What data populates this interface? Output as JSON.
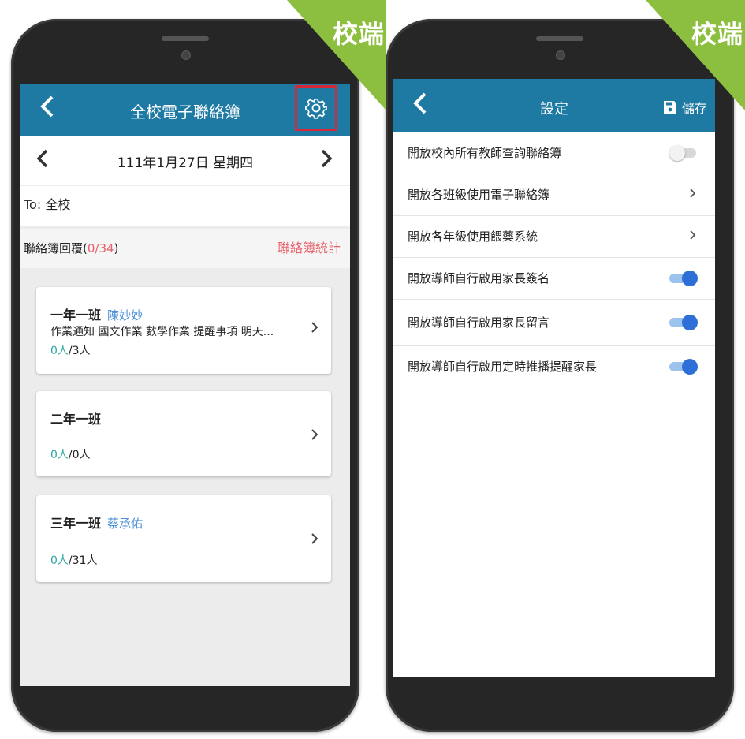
{
  "badges": {
    "left": "校端",
    "right": "校端"
  },
  "left_app": {
    "header": {
      "back_icon": "chevron-left-icon",
      "title": "全校電子聯絡簿",
      "settings_icon": "gear-icon"
    },
    "date_nav": {
      "prev_icon": "chevron-left-icon",
      "date": "111年1月27日 星期四",
      "next_icon": "chevron-right-icon"
    },
    "to_line": "To: 全校",
    "reply": {
      "label": "聯絡簿回覆(",
      "count": "0/34",
      "close": ")",
      "stats_link": "聯絡簿統計"
    },
    "classes": [
      {
        "name": "一年一班",
        "teacher": "陳妙妙",
        "notes": "作業通知 國文作業 數學作業 提醒事項 明天...",
        "replied": "0人",
        "total": "/3人"
      },
      {
        "name": "二年一班",
        "teacher": "",
        "notes": "",
        "replied": "0人",
        "total": "/0人"
      },
      {
        "name": "三年一班",
        "teacher": "蔡承佑",
        "notes": "",
        "replied": "0人",
        "total": "/31人"
      }
    ],
    "colors": {
      "header": "#1e7aa3",
      "accent_red": "#e8606a",
      "teal": "#2aa8a0"
    }
  },
  "right_app": {
    "header": {
      "back_icon": "chevron-left-icon",
      "title": "設定",
      "save_icon": "floppy-disk-icon",
      "save_label": "儲存"
    },
    "settings": [
      {
        "label": "開放校內所有教師查詢聯絡簿",
        "control": "toggle",
        "on": false
      },
      {
        "label": "開放各班級使用電子聯絡簿",
        "control": "chevron"
      },
      {
        "label": "開放各年級使用餵藥系統",
        "control": "chevron"
      },
      {
        "label": "開放導師自行啟用家長簽名",
        "control": "toggle",
        "on": true
      },
      {
        "label": "開放導師自行啟用家長留言",
        "control": "toggle",
        "on": true
      },
      {
        "label": "開放導師自行啟用定時推播提醒家長",
        "control": "toggle",
        "on": true
      }
    ],
    "colors": {
      "toggle_on": "#2d6fd6",
      "toggle_off": "#d8d8d8"
    }
  }
}
